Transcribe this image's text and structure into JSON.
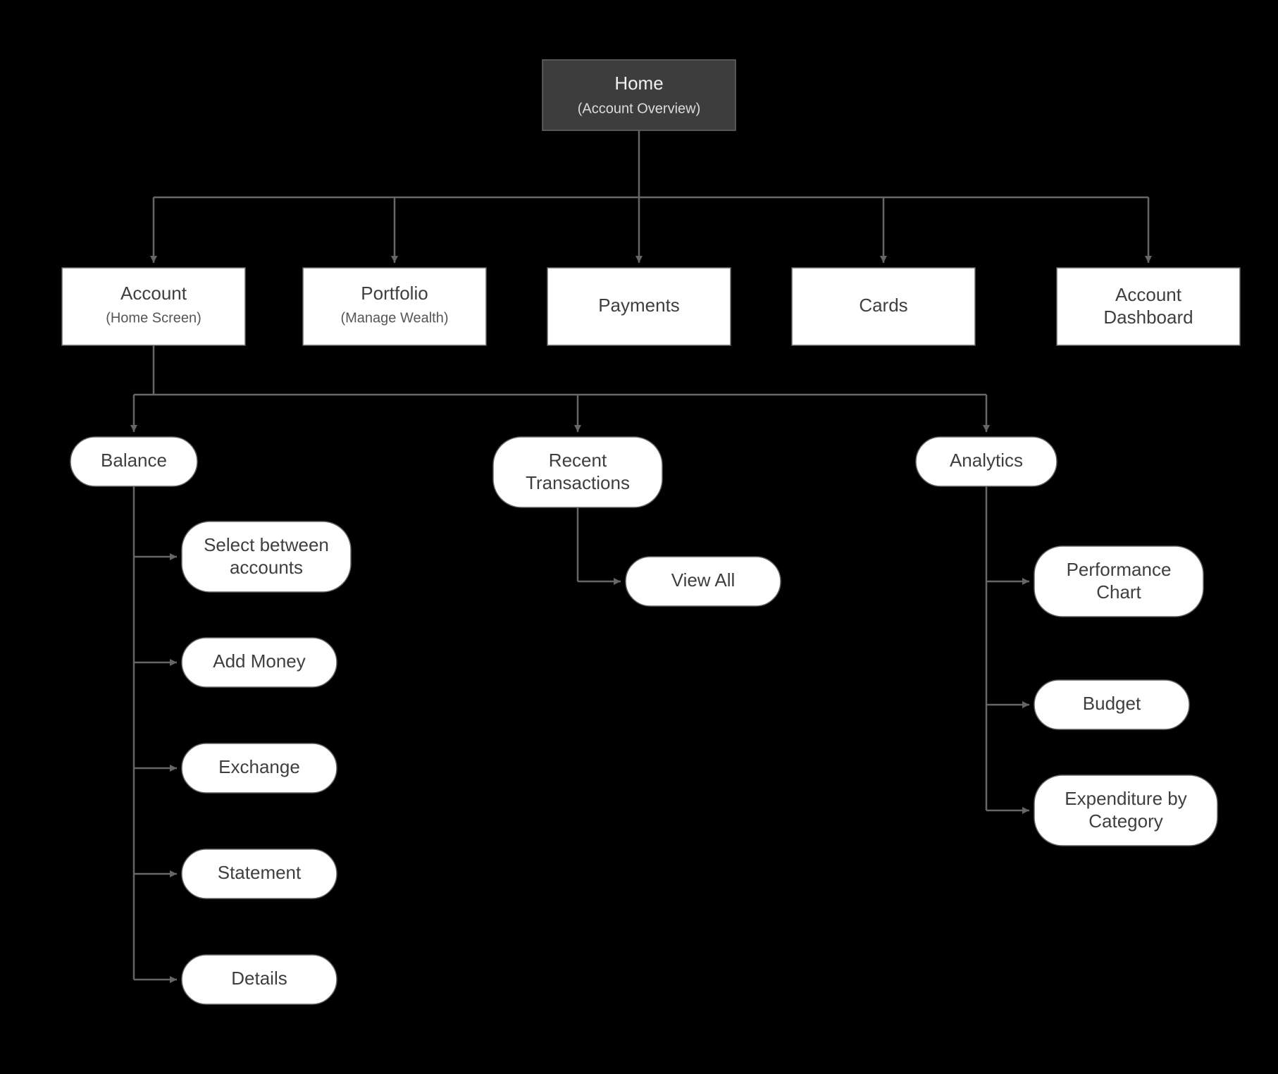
{
  "root": {
    "title": "Home",
    "subtitle": "(Account Overview)"
  },
  "level1": {
    "account": {
      "title": "Account",
      "subtitle": "(Home Screen)"
    },
    "portfolio": {
      "title": "Portfolio",
      "subtitle": "(Manage Wealth)"
    },
    "payments": {
      "title": "Payments"
    },
    "cards": {
      "title": "Cards"
    },
    "dashboard": {
      "line1": "Account",
      "line2": "Dashboard"
    }
  },
  "level2": {
    "balance": {
      "title": "Balance"
    },
    "transactions": {
      "line1": "Recent",
      "line2": "Transactions"
    },
    "analytics": {
      "title": "Analytics"
    }
  },
  "balance_items": {
    "select": {
      "line1": "Select between",
      "line2": "accounts"
    },
    "add_money": {
      "title": "Add Money"
    },
    "exchange": {
      "title": "Exchange"
    },
    "statement": {
      "title": "Statement"
    },
    "details": {
      "title": "Details"
    }
  },
  "transactions_items": {
    "view_all": {
      "title": "View All"
    }
  },
  "analytics_items": {
    "perf": {
      "line1": "Performance",
      "line2": "Chart"
    },
    "budget": {
      "title": "Budget"
    },
    "expend": {
      "line1": "Expenditure by",
      "line2": "Category"
    }
  }
}
